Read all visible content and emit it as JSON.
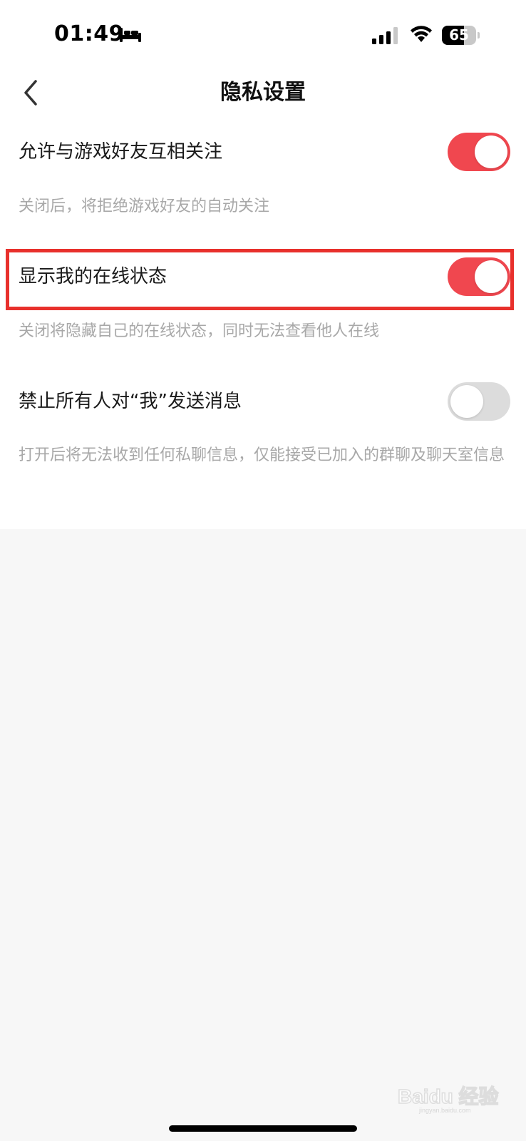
{
  "status_bar": {
    "time": "01:49",
    "battery_level": "65",
    "battery_fraction": 0.65
  },
  "header": {
    "title": "隐私设置"
  },
  "settings": [
    {
      "label": "允许与游戏好友互相关注",
      "description": "关闭后，将拒绝游戏好友的自动关注",
      "enabled": true
    },
    {
      "label": "显示我的在线状态",
      "description": "关闭将隐藏自己的在线状态，同时无法查看他人在线",
      "enabled": true
    },
    {
      "label": "禁止所有人对“我”发送消息",
      "description": "打开后将无法收到任何私聊信息，仅能接受已加入的群聊及聊天室信息",
      "enabled": false
    }
  ],
  "colors": {
    "toggle_on": "#f0474f",
    "toggle_off": "#dcdcdc",
    "highlight": "#e8302c"
  },
  "watermark": {
    "logo": "Bai du 经验",
    "sub": "jingyan.baidu.com"
  }
}
